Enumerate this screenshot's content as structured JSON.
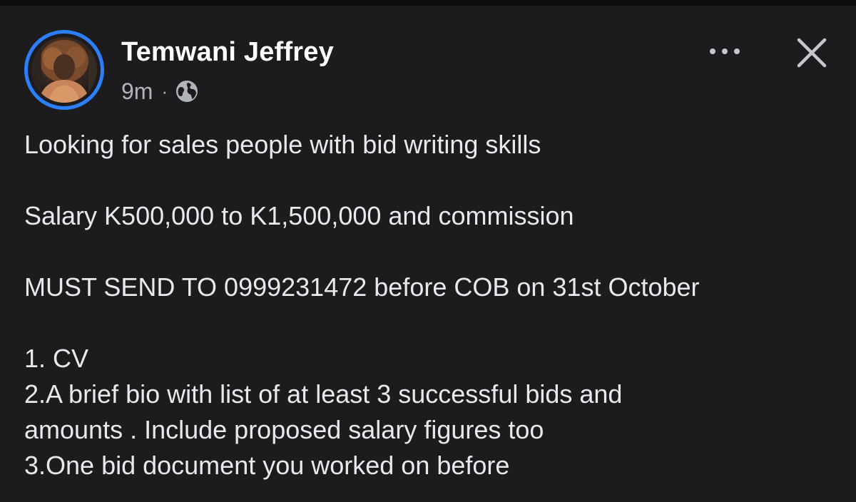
{
  "post": {
    "author_name": "Temwani Jeffrey",
    "timestamp": "9m",
    "separator": "·",
    "privacy_icon": "globe-icon",
    "menu_icon": "more-horizontal-icon",
    "close_icon": "close-icon",
    "accent_color": "#2d7ff9",
    "background_color": "#1c1c1e",
    "body": {
      "intro": "Looking for sales people with bid writing skills",
      "salary": "Salary K500,000 to K1,500,000 and commission",
      "deadline": "MUST SEND TO 0999231472 before COB on 31st October",
      "requirements": [
        "1. CV",
        "2.A brief bio with list of at least 3 successful bids and",
        "amounts . Include proposed salary figures too",
        "3.One bid document you worked on before"
      ]
    }
  }
}
